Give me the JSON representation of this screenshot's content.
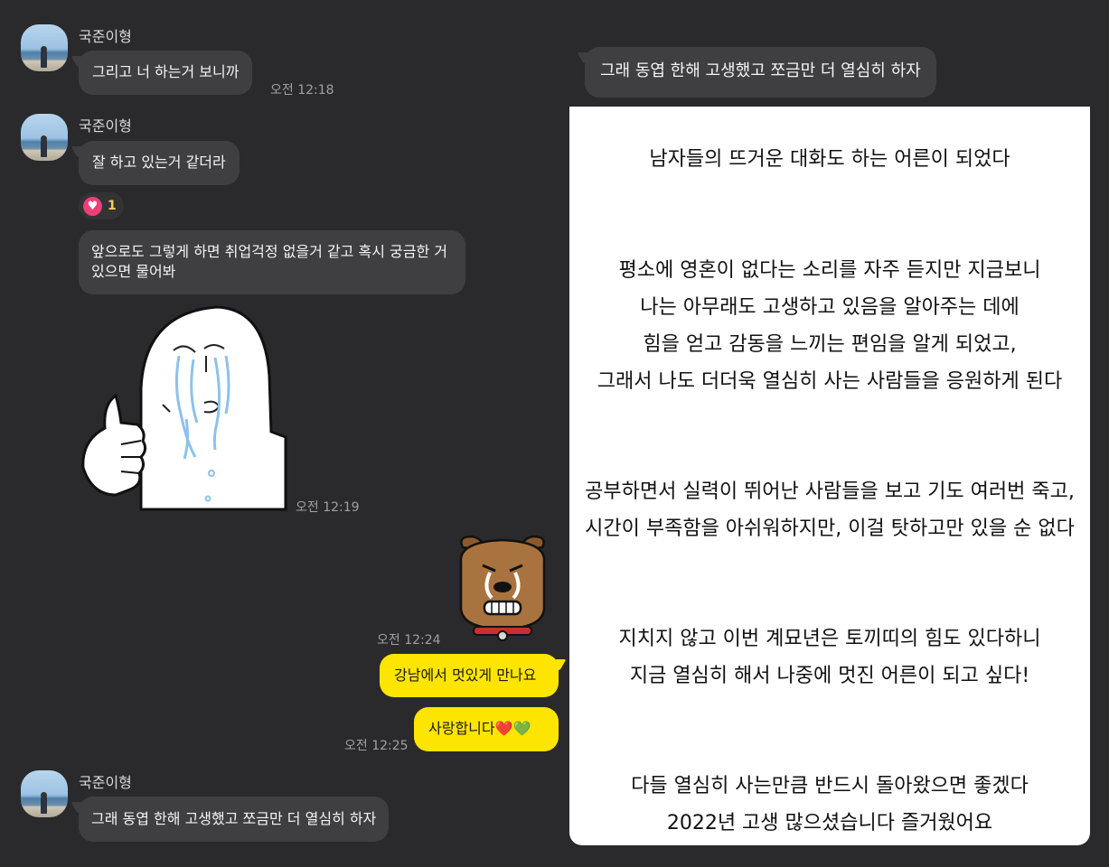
{
  "contacts": {
    "sender_name": "국준이형"
  },
  "messages": {
    "m1_text": "그리고 너 하는거 보니까",
    "m1_time": "오전 12:18",
    "m2_text": "잘 하고 있는거 같더라",
    "m2_reaction_count": "1",
    "m3_text": "앞으로도 그렇게 하면 취업걱정 없을거 같고 혹시 궁금한 거 있으면 물어봐",
    "sticker1_time": "오전 12:19",
    "sticker2_time": "오전 12:24",
    "y1_text": "강남에서 멋있게 만나요",
    "y2_text": "사랑합니다",
    "y2_emojis": "❤️💚",
    "y2_time": "오전 12:25",
    "m4_text": "그래 동엽 한해 고생했고 쪼금만 더 열심히 하자"
  },
  "top_bubble": {
    "text": "그래 동엽 한해 고생했고 쪼금만 더 열심히 하자"
  },
  "panel": {
    "lines": [
      "남자들의 뜨거운 대화도 하는 어른이 되었다",
      "평소에 영혼이 없다는 소리를 자주 듣지만 지금보니",
      "나는 아무래도 고생하고 있음을 알아주는 데에",
      "힘을 얻고 감동을 느끼는 편임을 알게 되었고,",
      "그래서 나도 더더욱 열심히 사는 사람들을 응원하게 된다",
      "공부하면서 실력이 뛰어난 사람들을 보고 기도 여러번 죽고,",
      "시간이 부족함을 아쉬워하지만, 이걸 탓하고만 있을 순 없다",
      "지치지 않고 이번 계묘년은 토끼띠의 힘도 있다하니",
      "지금 열심히 해서 나중에 멋진 어른이 되고 싶다!",
      "다들 열심히 사는만큼 반드시 돌아왔으면 좋겠다",
      "2022년 고생 많으셨습니다 즐거웠어요"
    ]
  },
  "colors": {
    "background": "#2a2a2c",
    "bubble_gray": "#3f3f42",
    "bubble_yellow": "#fee500",
    "reaction_heart": "#ef3f77"
  }
}
